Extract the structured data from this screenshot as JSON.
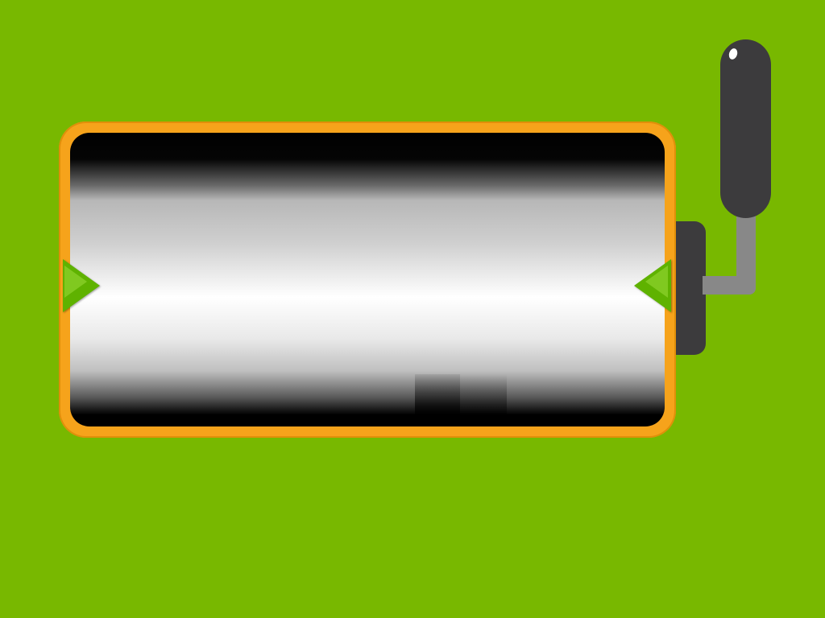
{
  "scene": {
    "background_color": "#78b800",
    "frame_color": "#f6a31b",
    "arrow_color": "#5fb200",
    "lever_color": "#3c3b3d",
    "lever_arm_color": "#888888"
  },
  "controls": {
    "left_arrow_icon": "triangle-right-icon",
    "right_arrow_icon": "triangle-left-icon",
    "lever_icon": "lever-handle-icon"
  }
}
